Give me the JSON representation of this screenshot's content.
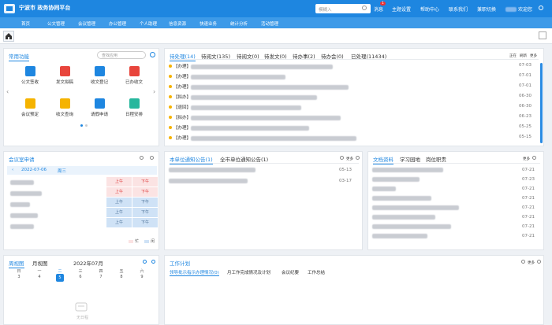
{
  "header": {
    "brand": "宁波市                    政务协同平台",
    "search_placeholder": "模糊入",
    "links": [
      "消息",
      "主题设置",
      "帮助中心",
      "联系我们",
      "兼职切换"
    ],
    "badge": "1",
    "welcome": "欢迎您"
  },
  "menu": [
    "首页",
    "公文管理",
    "会议管理",
    "办公管理",
    "个人助理",
    "信息资源",
    "快速业务",
    "统计分析",
    "活动管理"
  ],
  "common": {
    "title": "常用功能",
    "search_placeholder": "查找应用",
    "apps": [
      {
        "label": "公文签收",
        "color": "#1e86e0"
      },
      {
        "label": "发文拟稿",
        "color": "#e8453c"
      },
      {
        "label": "收文登记",
        "color": "#1e86e0"
      },
      {
        "label": "已办收文",
        "color": "#e8453c"
      },
      {
        "label": "会议预定",
        "color": "#f5b300"
      },
      {
        "label": "收文查询",
        "color": "#f5b300"
      },
      {
        "label": "请假申请",
        "color": "#1e86e0"
      },
      {
        "label": "日程安排",
        "color": "#27b79d"
      }
    ]
  },
  "pending": {
    "tabs": [
      "待处理(14)",
      "待阅文(135)",
      "待阅文(0)",
      "待发文(0)",
      "待办事(2)",
      "待办会(0)",
      "已处理(11434)"
    ],
    "tools": [
      "正在",
      "刷新",
      "更多"
    ],
    "rows": [
      {
        "tag": "【办理】",
        "date": "07-03"
      },
      {
        "tag": "【办理】",
        "date": "07-01"
      },
      {
        "tag": "【办理】",
        "date": "07-01"
      },
      {
        "tag": "【拟办】",
        "date": "06-30"
      },
      {
        "tag": "【退回】",
        "date": "06-30"
      },
      {
        "tag": "【拟办】",
        "date": "06-23"
      },
      {
        "tag": "【办理】",
        "date": "05-25"
      },
      {
        "tag": "【办理】",
        "date": "05-15"
      }
    ]
  },
  "meeting": {
    "title": "会议室申请",
    "date": "2022-07-06",
    "weekday": "周三",
    "am": "上午",
    "pm": "下午",
    "legend": [
      "忙",
      "闲"
    ]
  },
  "notice": {
    "tabs": [
      "本单位通知公告(1)",
      "全市单位通知公告(1)"
    ],
    "more": "更多",
    "rows": [
      {
        "date": "05-13"
      },
      {
        "date": "03-17"
      }
    ]
  },
  "docs": {
    "tabs": [
      "文档资料",
      "学习园地",
      "岗位职责"
    ],
    "more": "更多",
    "dates": [
      "07-21",
      "07-23",
      "07-21",
      "07-21",
      "07-21",
      "07-21",
      "07-21",
      "07-21"
    ]
  },
  "calendar": {
    "tabs": [
      "周视图",
      "月视图"
    ],
    "month": "2022年07月",
    "days": [
      "日",
      "一",
      "二",
      "三",
      "四",
      "五",
      "六"
    ],
    "nums": [
      "3",
      "4",
      "5",
      "6",
      "7",
      "8",
      "9"
    ],
    "empty": "无日程"
  },
  "plan": {
    "title": "工作计划",
    "more": "更多",
    "tabs": [
      "领导批示指示办理情况(0)",
      "月工作完成情况及计划",
      "会议纪要",
      "工作总结"
    ]
  }
}
